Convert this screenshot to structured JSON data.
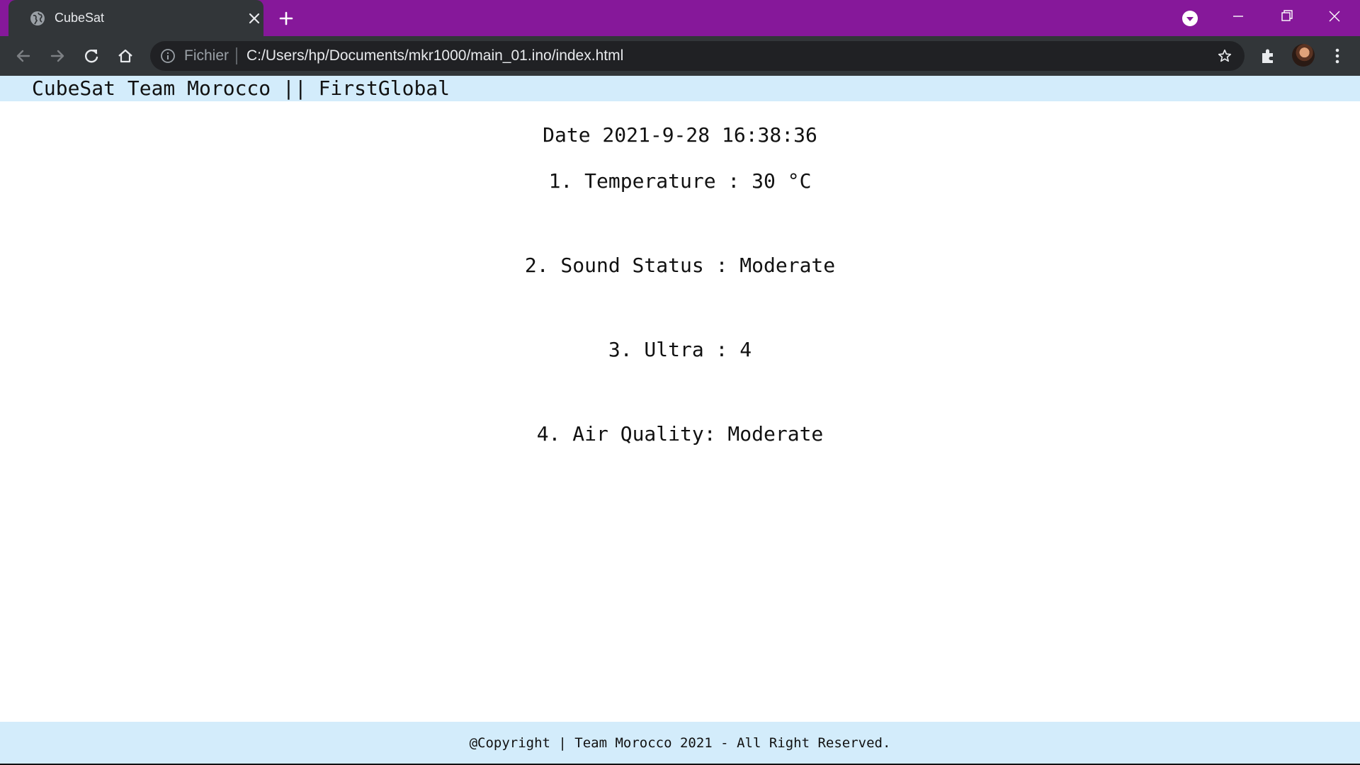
{
  "browser": {
    "tab": {
      "title": "CubeSat",
      "favicon": "globe-icon"
    },
    "new_tab_icon": "plus-icon",
    "omnibox": {
      "scheme_label": "Fichier",
      "url": "C:/Users/hp/Documents/mkr1000/main_01.ino/index.html"
    },
    "colors": {
      "titlebar": "#86189a",
      "toolbar": "#323639",
      "omnibox": "#202124"
    }
  },
  "page": {
    "header_title": "CubeSat Team Morocco || FirstGlobal",
    "readings": {
      "date": "Date 2021-9-28 16:38:36",
      "temperature": "1. Temperature : 30 °C",
      "sound": "2. Sound Status : Moderate",
      "ultra": "3. Ultra : 4",
      "air": "4. Air Quality: Moderate"
    },
    "footer_text": "@Copyright | Team Morocco 2021 - All Right Reserved.",
    "colors": {
      "header_bg": "#d3ecfb",
      "footer_bg": "#d3ecfb",
      "text": "#111111"
    }
  }
}
